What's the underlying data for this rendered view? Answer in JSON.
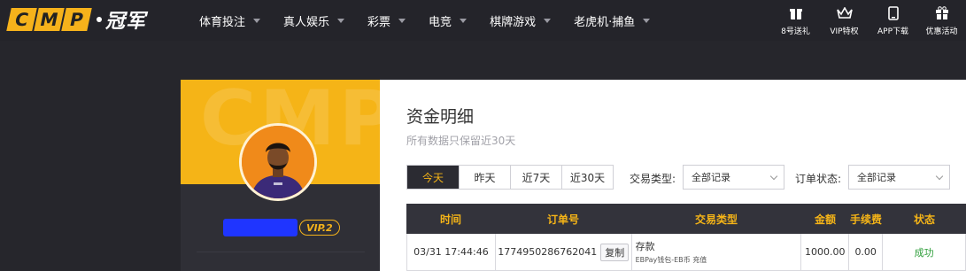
{
  "brand": {
    "letters": [
      "C",
      "M",
      "P"
    ],
    "cn": "冠军"
  },
  "nav": [
    {
      "label": "体育投注"
    },
    {
      "label": "真人娱乐"
    },
    {
      "label": "彩票"
    },
    {
      "label": "电竞"
    },
    {
      "label": "棋牌游戏"
    },
    {
      "label": "老虎机·捕鱼"
    }
  ],
  "quick_links": [
    {
      "label": "8号送礼",
      "icon": "gift-box-icon"
    },
    {
      "label": "VIP特权",
      "icon": "crown-icon"
    },
    {
      "label": "APP下载",
      "icon": "phone-icon"
    },
    {
      "label": "优惠活动",
      "icon": "gift-icon"
    }
  ],
  "profile": {
    "watermark": "CMP",
    "vip_level": "VIP.2"
  },
  "page": {
    "title": "资金明细",
    "subtitle": "所有数据只保留近30天",
    "range_tabs": [
      "今天",
      "昨天",
      "近7天",
      "近30天"
    ],
    "active_tab": "今天",
    "txn_type_label": "交易类型:",
    "txn_type_value": "全部记录",
    "order_status_label": "订单状态:",
    "order_status_value": "全部记录"
  },
  "table": {
    "headers": [
      "时间",
      "订单号",
      "交易类型",
      "金额",
      "手续费",
      "状态"
    ],
    "rows": [
      {
        "time": "03/31 17:44:46",
        "order_no": "1774950286762041",
        "copy_label": "复制",
        "type_main": "存款",
        "type_detail": "EBPay钱包-EB币 充值",
        "amount": "1000.00",
        "fee": "0.00",
        "status": "成功"
      }
    ]
  },
  "colors": {
    "accent": "#f5b417",
    "nav_bg": "#24242a",
    "page_bg": "#26262c",
    "success": "#2e9e3a"
  }
}
